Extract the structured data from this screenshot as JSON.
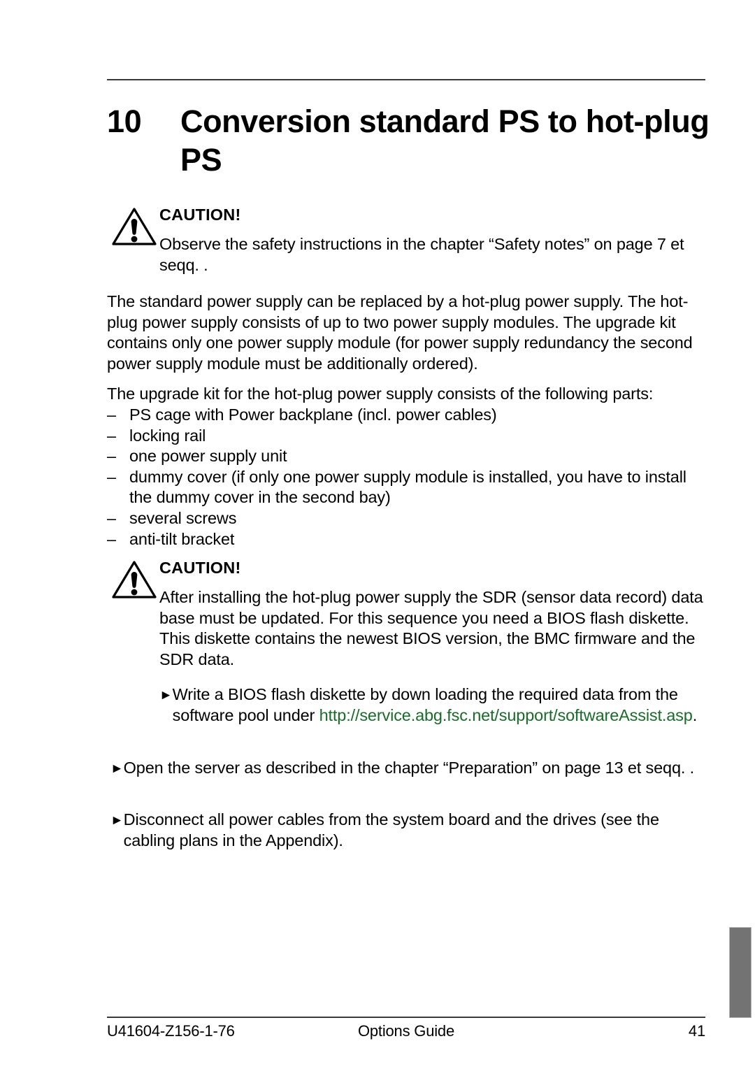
{
  "heading": {
    "number": "10",
    "title": "Conversion standard PS to hot-plug PS"
  },
  "caution1": {
    "title": "CAUTION!",
    "icon": "warning-triangle-icon",
    "text": "Observe the safety instructions in the chapter “Safety notes” on page 7 et seqq. ."
  },
  "paragraph1": "The standard power supply can be replaced by a hot-plug power supply. The hot-plug power supply consists of up to two power supply modules. The upgrade kit contains only one power supply module (for power supply redundancy the second power supply module must be additionally ordered).",
  "parts_intro": "The upgrade kit for the hot-plug power supply consists of the following parts:",
  "parts_marker": "–",
  "parts": [
    "PS cage with Power backplane (incl. power cables)",
    "locking rail",
    "one power supply unit",
    "dummy cover (if only one power supply module is installed, you have to install the dummy cover in the second bay)",
    "several screws",
    "anti-tilt bracket"
  ],
  "caution2": {
    "title": "CAUTION!",
    "icon": "warning-triangle-icon",
    "text": "After installing the hot-plug power supply the SDR (sensor data record) data base must be updated. For this sequence you need a BIOS flash diskette. This diskette contains the newest BIOS version, the BMC firmware and the SDR data."
  },
  "step_marker": "►",
  "steps": [
    {
      "text": "Write a BIOS flash diskette by down loading the required data from the software pool under ",
      "url": "http://service.abg.fsc.net/support/softwareAssist.asp",
      "url_suffix": "."
    },
    {
      "text": "Open the server as described in the chapter “Preparation” on page 13 et seqq. ."
    },
    {
      "text": "Disconnect all power cables from the system board and the drives (see the cabling plans in the Appendix)."
    }
  ],
  "footer": {
    "document_id": "U41604-Z156-1-76",
    "guide_title": "Options Guide",
    "page_number": "41"
  },
  "colors": {
    "link_green": "#1a6b2a",
    "rule_gray": "#3a3a3a",
    "tab_gray": "#737373"
  }
}
